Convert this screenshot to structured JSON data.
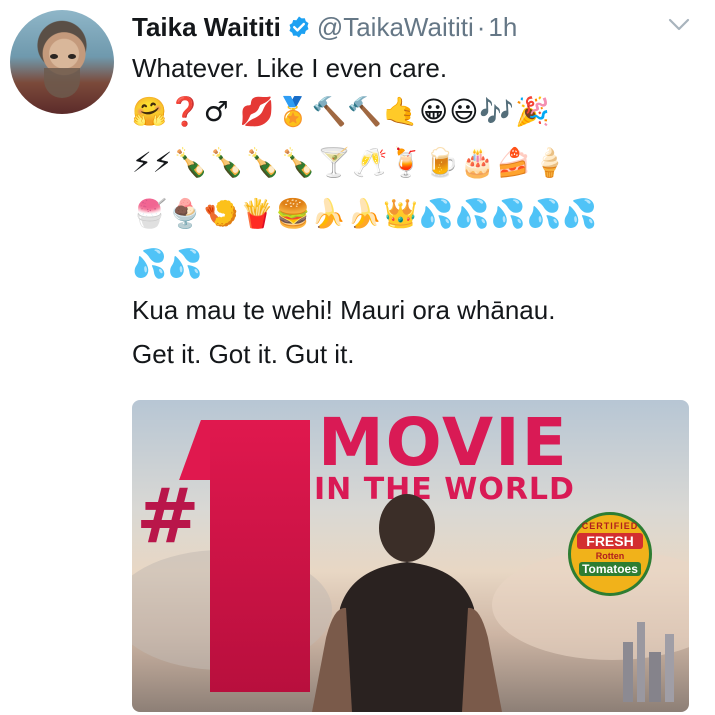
{
  "tweet": {
    "author_name": "Taika Waititi",
    "handle": "@TaikaWaititi",
    "separator": "·",
    "time": "1h",
    "text_line1": "Whatever. Like I even care.",
    "emoji_rows": [
      "🤗❓♂ 💋🏅🔨🔨🤙😀😃🎶🎉",
      "⚡⚡🍾🍾🍾🍾🍸🥂🍹🍺🎂🍰🍦",
      "🍧🍨🍤🍟🍔🍌🍌👑💦💦💦💦💦",
      "💦💦"
    ],
    "text_line2": "Kua mau te wehi! Mauri ora whānau.",
    "text_line3": "Get it. Got it. Gut it."
  },
  "media": {
    "hash": "#",
    "headline": "MOVIE",
    "subheadline": "IN THE WORLD",
    "badge": {
      "certified": "CERTIFIED",
      "fresh": "FRESH",
      "rotten": "Rotten",
      "tomatoes": "Tomatoes"
    }
  },
  "colors": {
    "verified": "#1da1f2",
    "muted": "#657786",
    "headline": "#d91a55"
  },
  "icons": {
    "verified": "verified-check-icon",
    "more": "chevron-down-icon"
  }
}
